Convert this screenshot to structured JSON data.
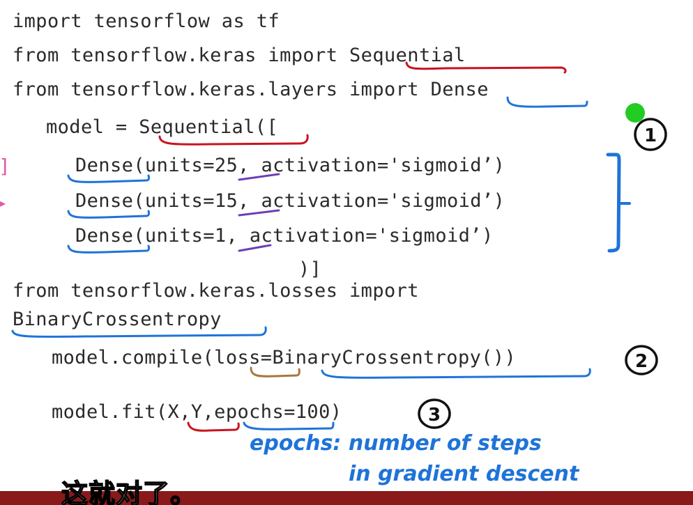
{
  "code_lines": [
    "import tensorflow as tf",
    "from tensorflow.keras import Sequential",
    "from tensorflow.keras.layers import Dense",
    "model = Sequential([",
    "Dense(units=25, activation='sigmoid’)",
    "Dense(units=15, activation='sigmoid’)",
    "Dense(units=1, activation='sigmoid’)",
    ")]",
    "from tensorflow.keras.losses import",
    "BinaryCrossentropy",
    "model.compile(loss=BinaryCrossentropy())",
    "model.fit(X,Y,epochs=100)"
  ],
  "annotations": {
    "step1": "1",
    "step2": "2",
    "step3": "3",
    "note_line1": "epochs: number of steps",
    "note_line2": "in gradient descent"
  },
  "subtitle": "这就对了。",
  "colors": {
    "red_ink": "#c8141e",
    "blue_ink": "#1e73d8",
    "purple_ink": "#6a3fb5",
    "brown_ink": "#a8763e",
    "green_dot": "#22cc22",
    "subtitle_bar": "#8a1a1a"
  }
}
